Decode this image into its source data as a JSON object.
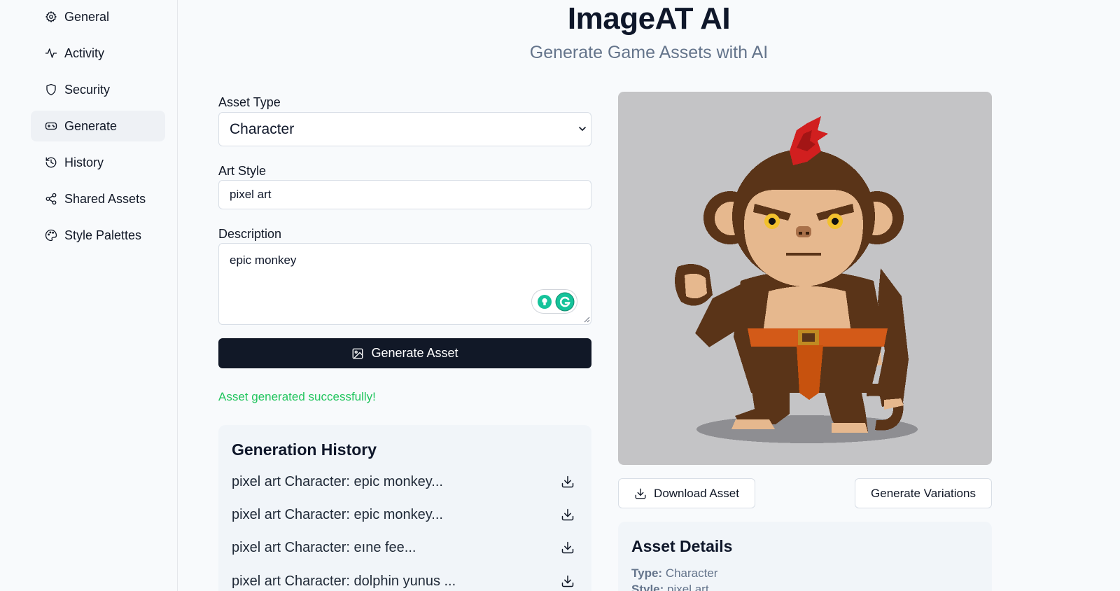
{
  "sidebar": {
    "items": [
      {
        "label": "General",
        "icon": "gear-icon"
      },
      {
        "label": "Activity",
        "icon": "activity-icon"
      },
      {
        "label": "Security",
        "icon": "shield-icon"
      },
      {
        "label": "Generate",
        "icon": "gamepad-icon",
        "active": true
      },
      {
        "label": "History",
        "icon": "history-icon"
      },
      {
        "label": "Shared Assets",
        "icon": "share-icon"
      },
      {
        "label": "Style Palettes",
        "icon": "palette-icon"
      }
    ]
  },
  "header": {
    "title": "ImageAT AI",
    "subtitle": "Generate Game Assets with AI"
  },
  "form": {
    "asset_type_label": "Asset Type",
    "asset_type_value": "Character",
    "art_style_label": "Art Style",
    "art_style_value": "pixel art",
    "description_label": "Description",
    "description_value": "epic monkey",
    "generate_button": "Generate Asset",
    "status_message": "Asset generated successfully!"
  },
  "history": {
    "title": "Generation History",
    "items": [
      "pixel art Character: epic monkey...",
      "pixel art Character: epic monkey...",
      "pixel art Character: eıne fee...",
      "pixel art Character: dolphin yunus ..."
    ]
  },
  "preview": {
    "image_alt": "pixel art monkey character",
    "download_button": "Download Asset",
    "variations_button": "Generate Variations"
  },
  "details": {
    "title": "Asset Details",
    "type_label": "Type:",
    "type_value": "Character",
    "style_label": "Style:",
    "style_value": "pixel art"
  },
  "colors": {
    "primary_button": "#111827",
    "success": "#22c55e",
    "subtitle": "#64748b",
    "grammarly": "#15c39a"
  }
}
